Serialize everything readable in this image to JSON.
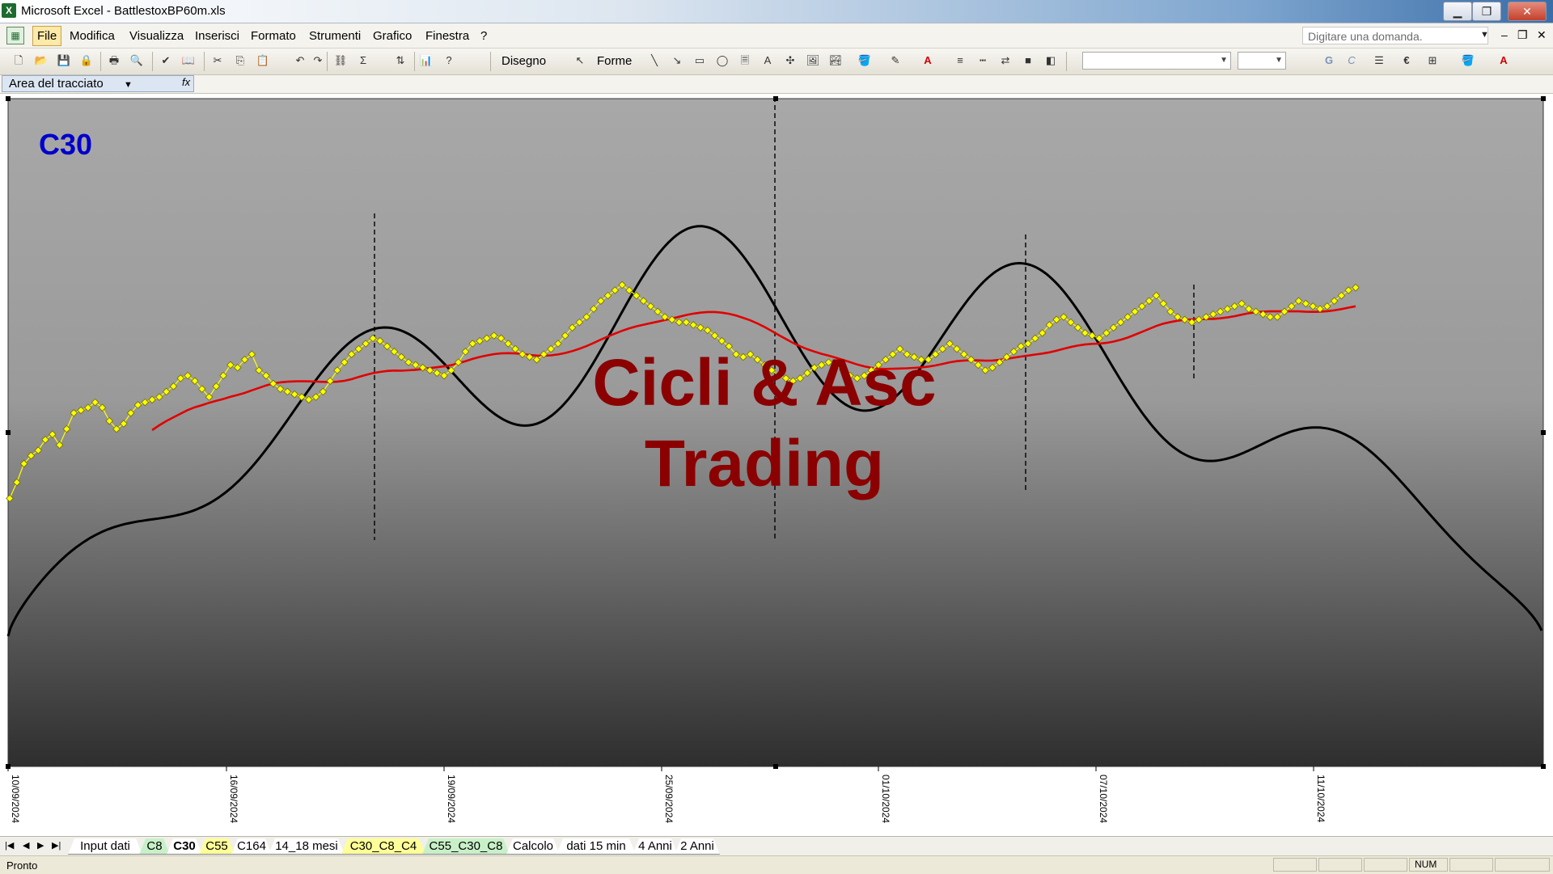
{
  "window": {
    "title": "Microsoft Excel - BattlestoxBP60m.xls",
    "app_icon": "excel-icon"
  },
  "menubar": {
    "items": [
      "File",
      "Modifica",
      "Visualizza",
      "Inserisci",
      "Formato",
      "Strumenti",
      "Grafico",
      "Finestra",
      "?"
    ],
    "ask_placeholder": "Digitare una domanda."
  },
  "toolbar": {
    "draw_label": "Disegno",
    "shapes_label": "Forme",
    "font_bold": "G",
    "font_italic": "C",
    "euro": "€"
  },
  "formula_bar": {
    "name_box": "Area del tracciato",
    "fx": "fx"
  },
  "chart": {
    "series_label": "C30",
    "watermark_line1": "Cicli & Asc",
    "watermark_line2": "Trading",
    "colors": {
      "price": "#ffff00",
      "moving_average": "#e00000",
      "cycle": "#000000",
      "label": "#0000cc",
      "watermark": "#8b0000"
    }
  },
  "chart_data": {
    "type": "line",
    "x_tick_labels": [
      "10/09/2024",
      "16/09/2024",
      "19/09/2024",
      "25/09/2024",
      "01/10/2024",
      "07/10/2024",
      "11/10/2024"
    ],
    "series": [
      {
        "kind": "price",
        "marker": "diamond",
        "values": [
          12,
          18,
          25,
          28,
          30,
          34,
          36,
          32,
          38,
          44,
          45,
          46,
          48,
          46,
          41,
          38,
          40,
          44,
          47,
          48,
          49,
          50,
          52,
          54,
          57,
          58,
          56,
          53,
          50,
          54,
          58,
          62,
          61,
          64,
          66,
          60,
          58,
          55,
          53,
          52,
          51,
          50,
          49,
          50,
          52,
          56,
          60,
          63,
          66,
          68,
          70,
          72,
          71,
          69,
          67,
          65,
          63,
          62,
          61,
          60,
          59,
          58,
          60,
          63,
          67,
          70,
          71,
          72,
          73,
          72,
          70,
          68,
          66,
          65,
          64,
          66,
          68,
          70,
          73,
          76,
          78,
          80,
          83,
          86,
          88,
          90,
          92,
          90,
          88,
          86,
          84,
          82,
          80,
          79,
          78,
          78,
          77,
          76,
          75,
          73,
          71,
          69,
          66,
          65,
          66,
          64,
          62,
          60,
          58,
          57,
          56,
          57,
          59,
          61,
          62,
          63,
          62,
          60,
          58,
          57,
          58,
          60,
          62,
          64,
          66,
          68,
          66,
          65,
          64,
          64,
          66,
          68,
          70,
          68,
          66,
          64,
          62,
          60,
          61,
          63,
          65,
          67,
          69,
          70,
          72,
          74,
          77,
          79,
          80,
          78,
          76,
          74,
          73,
          72,
          74,
          76,
          78,
          80,
          82,
          84,
          86,
          88,
          85,
          82,
          80,
          79,
          78,
          79,
          80,
          81,
          82,
          83,
          84,
          85,
          83,
          82,
          81,
          80,
          80,
          82,
          84,
          86,
          85,
          84,
          83,
          84,
          86,
          88,
          90,
          91
        ],
        "ylim": [
          0,
          100
        ]
      },
      {
        "kind": "moving_average"
      },
      {
        "kind": "cycle"
      }
    ],
    "grid": false,
    "vertical_markers": [
      "dashed"
    ]
  },
  "sheet_tabs": [
    {
      "label": "Input dati",
      "color": "#ffffff"
    },
    {
      "label": "C8",
      "color": "#c8f0c8"
    },
    {
      "label": "C30",
      "color": "#ffffff",
      "active": true
    },
    {
      "label": "C55",
      "color": "#ffff99"
    },
    {
      "label": "C164",
      "color": "#ffffff"
    },
    {
      "label": "14_18 mesi",
      "color": "#ffffff"
    },
    {
      "label": "C30_C8_C4",
      "color": "#ffff99"
    },
    {
      "label": "C55_C30_C8",
      "color": "#c8f0c8"
    },
    {
      "label": "Calcolo",
      "color": "#ffffff"
    },
    {
      "label": "dati 15 min",
      "color": "#ffffff"
    },
    {
      "label": "4 Anni",
      "color": "#ffffff"
    },
    {
      "label": "2 Anni",
      "color": "#ffffff"
    }
  ],
  "status": {
    "text": "Pronto",
    "num": "NUM"
  }
}
